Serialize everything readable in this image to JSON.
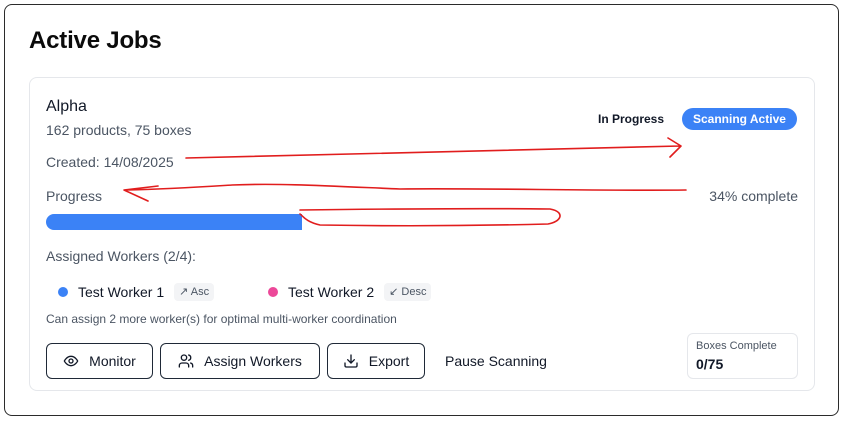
{
  "page": {
    "title": "Active Jobs"
  },
  "job": {
    "name": "Alpha",
    "meta": "162 products, 75 boxes",
    "created": "Created: 14/08/2025",
    "status_text": "In Progress",
    "badge_text": "Scanning Active",
    "progress": {
      "label": "Progress",
      "percent_text": "34% complete",
      "value_percent": 34
    },
    "workers": {
      "title": "Assigned Workers (2/4):",
      "items": [
        {
          "name": "Test Worker 1",
          "direction": "↗ Asc",
          "color": "#3b82f6"
        },
        {
          "name": "Test Worker 2",
          "direction": "↙ Desc",
          "color": "#ec4899"
        }
      ],
      "hint": "Can assign 2 more worker(s) for optimal multi-worker coordination"
    },
    "actions": {
      "monitor": "Monitor",
      "assign_workers": "Assign Workers",
      "export": "Export",
      "pause": "Pause Scanning"
    },
    "boxes": {
      "label": "Boxes Complete",
      "value": "0/75"
    }
  },
  "colors": {
    "accent": "#3b82f6",
    "annotation": "#e11d1d"
  },
  "icons": {
    "monitor": "eye-icon",
    "assign": "users-icon",
    "export": "download-icon"
  }
}
